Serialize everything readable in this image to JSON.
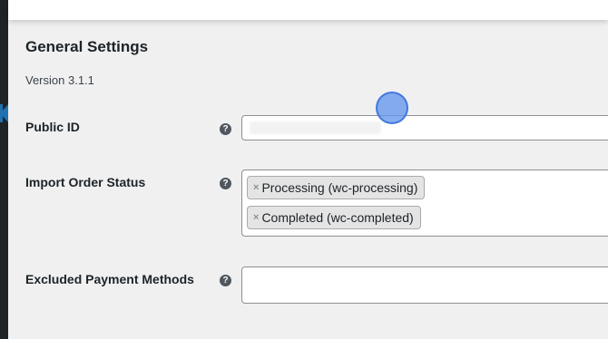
{
  "section": {
    "title": "General Settings",
    "version": "Version 3.1.1"
  },
  "fields": {
    "public_id": {
      "label": "Public ID",
      "help_icon": "question-circle-icon",
      "value": ""
    },
    "import_order_status": {
      "label": "Import Order Status",
      "help_icon": "question-circle-icon",
      "selected": [
        {
          "remove": "×",
          "label": "Processing (wc-processing)"
        },
        {
          "remove": "×",
          "label": "Completed (wc-completed)"
        }
      ]
    },
    "excluded_payment_methods": {
      "label": "Excluded Payment Methods",
      "help_icon": "question-circle-icon",
      "value": ""
    }
  },
  "help_glyph": "?",
  "colors": {
    "page_background": "#f0f0f1",
    "admin_sidebar": "#1d2327",
    "active_menu_accent": "#2271b1",
    "field_border": "#8c8f94",
    "chip_background": "#e4e4e4",
    "cursor_highlight": "#6496eb"
  }
}
